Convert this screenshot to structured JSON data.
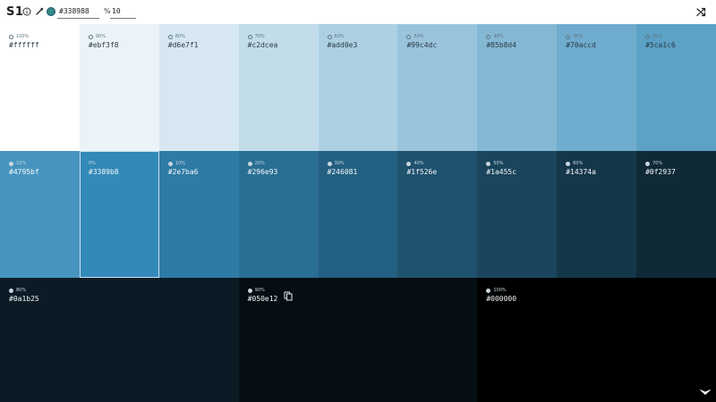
{
  "app": {
    "logo": "S1"
  },
  "toolbar": {
    "swatch_color": "#338988",
    "hex_value": "#338988",
    "step_value": "10",
    "icons": [
      "info-icon",
      "pipette-icon",
      "percent-icon",
      "shuffle-icon"
    ]
  },
  "swatches": [
    {
      "pct": "100%",
      "hex": "#ffffff",
      "bg": "#ffffff",
      "theme": "light"
    },
    {
      "pct": "90%",
      "hex": "#ebf3f8",
      "bg": "#ebf3f8",
      "theme": "light"
    },
    {
      "pct": "80%",
      "hex": "#d6e7f1",
      "bg": "#d6e7f1",
      "theme": "light"
    },
    {
      "pct": "70%",
      "hex": "#c2dcea",
      "bg": "#c2dcea",
      "theme": "light"
    },
    {
      "pct": "60%",
      "hex": "#add0e3",
      "bg": "#add0e3",
      "theme": "light"
    },
    {
      "pct": "50%",
      "hex": "#99c4dc",
      "bg": "#99c4dc",
      "theme": "light"
    },
    {
      "pct": "40%",
      "hex": "#85b8d4",
      "bg": "#85b8d4",
      "theme": "light"
    },
    {
      "pct": "30%",
      "hex": "#70accd",
      "bg": "#70accd",
      "theme": "light"
    },
    {
      "pct": "20%",
      "hex": "#5ca1c6",
      "bg": "#5ca1c6",
      "theme": "light"
    },
    {
      "pct": "10%",
      "hex": "#4795bf",
      "bg": "#4795bf",
      "theme": "dark"
    },
    {
      "pct": "0%",
      "hex": "#3389b8",
      "bg": "#3389b8",
      "theme": "dark",
      "selected": true
    },
    {
      "pct": "10%",
      "hex": "#2e7ba6",
      "bg": "#2e7ba6",
      "theme": "dark"
    },
    {
      "pct": "20%",
      "hex": "#296e93",
      "bg": "#296e93",
      "theme": "dark"
    },
    {
      "pct": "30%",
      "hex": "#246081",
      "bg": "#246081",
      "theme": "dark"
    },
    {
      "pct": "40%",
      "hex": "#1f526e",
      "bg": "#1f526e",
      "theme": "dark"
    },
    {
      "pct": "50%",
      "hex": "#1a455c",
      "bg": "#1a455c",
      "theme": "dark"
    },
    {
      "pct": "60%",
      "hex": "#14374a",
      "bg": "#14374a",
      "theme": "dark"
    },
    {
      "pct": "70%",
      "hex": "#0f2937",
      "bg": "#0f2937",
      "theme": "dark"
    },
    {
      "pct": "80%",
      "hex": "#0a1b25",
      "bg": "#0a1b25",
      "theme": "dark",
      "wide": true
    },
    {
      "pct": "90%",
      "hex": "#050e12",
      "bg": "#050e12",
      "theme": "dark",
      "wide": true,
      "copy": true
    },
    {
      "pct": "100%",
      "hex": "#000000",
      "bg": "#000000",
      "theme": "dark",
      "wide": true
    }
  ],
  "footer_icons": [
    "expand-icon"
  ]
}
